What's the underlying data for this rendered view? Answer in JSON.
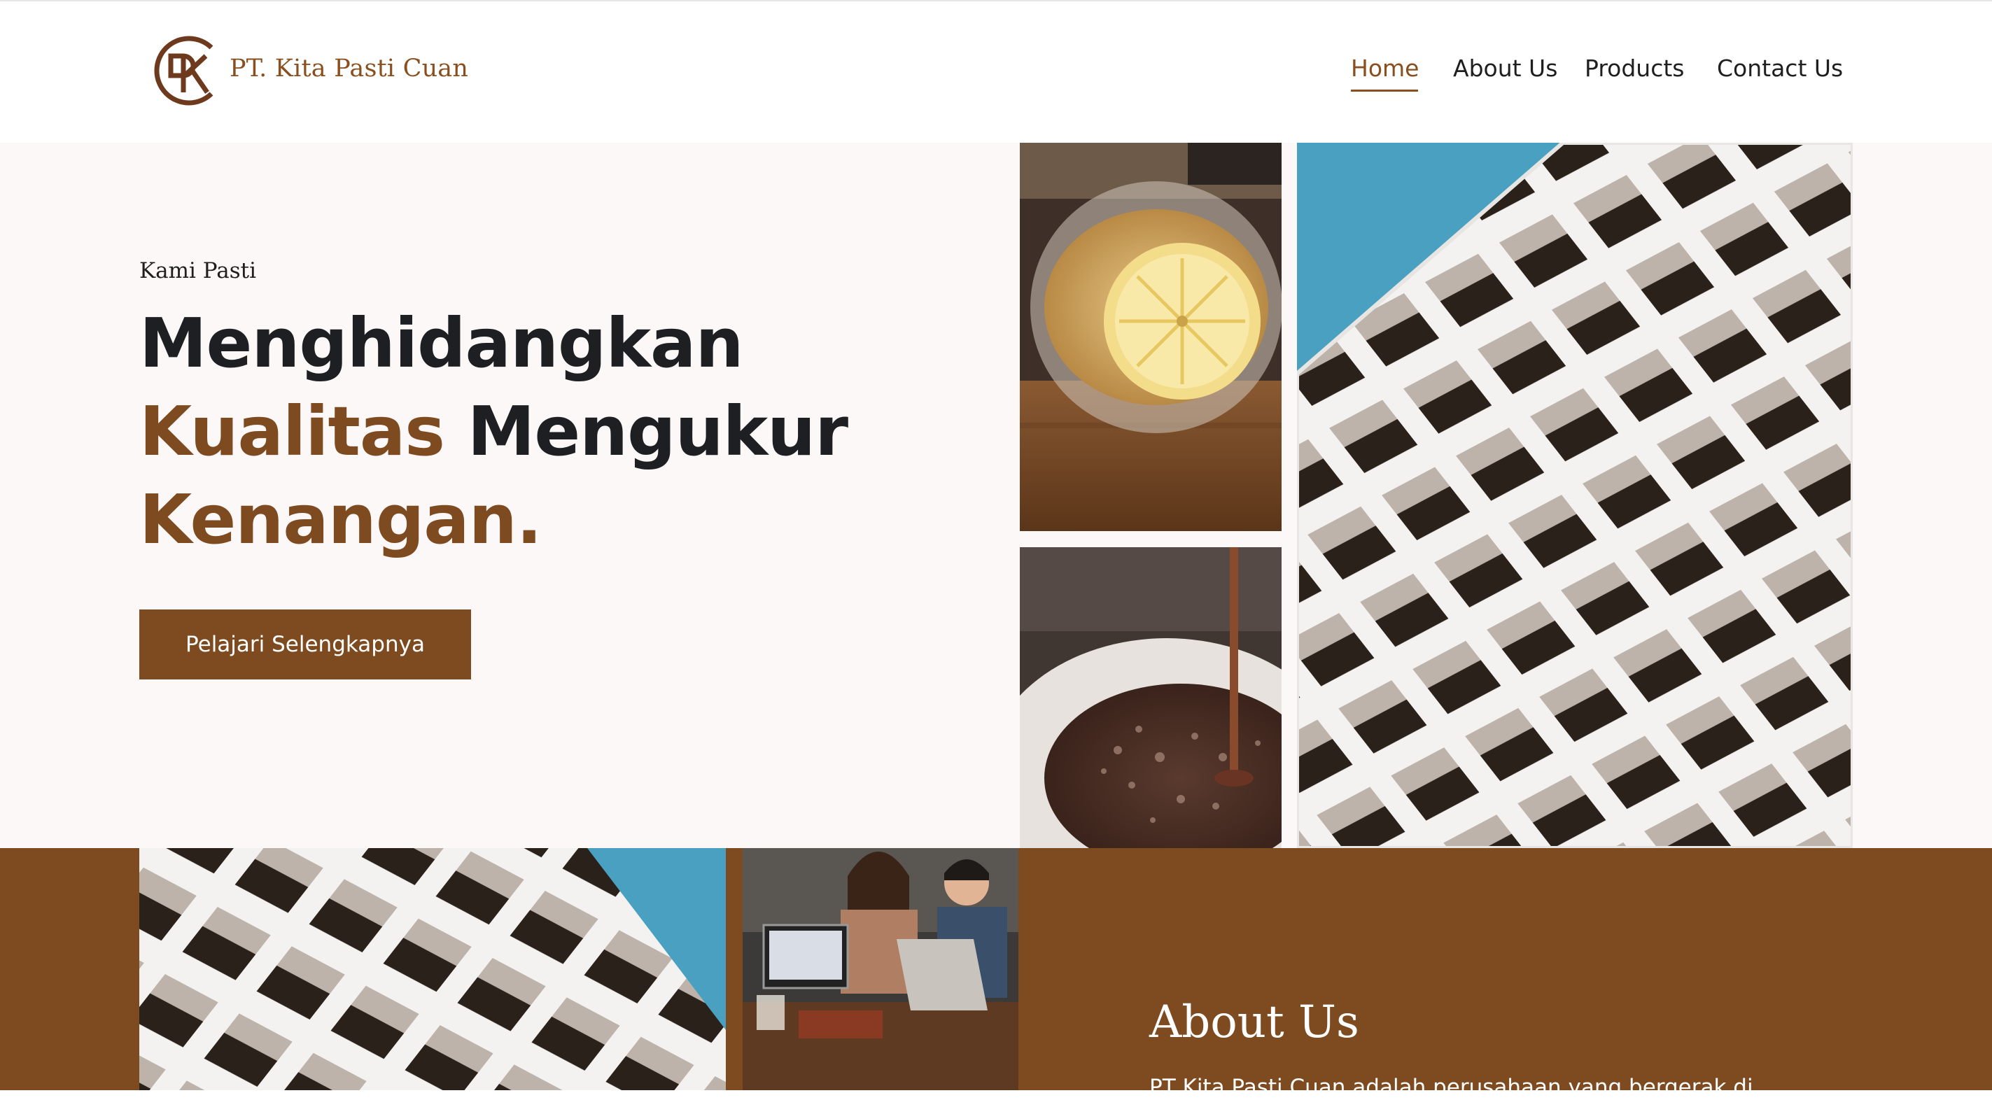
{
  "brand": {
    "name": "PT. Kita Pasti Cuan",
    "logo_letters": "PK",
    "color": "#8a4f1f"
  },
  "nav": {
    "items": [
      {
        "label": "Home",
        "active": true
      },
      {
        "label": "About Us",
        "active": false
      },
      {
        "label": "Products",
        "active": false
      },
      {
        "label": "Contact Us",
        "active": false
      }
    ]
  },
  "hero": {
    "eyebrow": "Kami Pasti",
    "headline": {
      "line1": "Menghidangkan",
      "line2_accent": "Kualitas",
      "line2_rest": " Mengukur",
      "line3_accent": "Kenangan."
    },
    "cta_label": "Pelajari Selengkapnya",
    "images": [
      "tea-with-lemon-photo",
      "coffee-pour-photo",
      "white-building-facade-photo"
    ]
  },
  "about": {
    "title": "About Us",
    "text_partial": "PT Kita Pasti Cuan adalah perusahaan yang bergerak di",
    "images": [
      "white-building-facade-photo",
      "people-working-cafe-photo"
    ]
  },
  "colors": {
    "accent": "#7e4a1f",
    "hero_bg": "#fcf8f7",
    "text_dark": "#1e1f23"
  }
}
